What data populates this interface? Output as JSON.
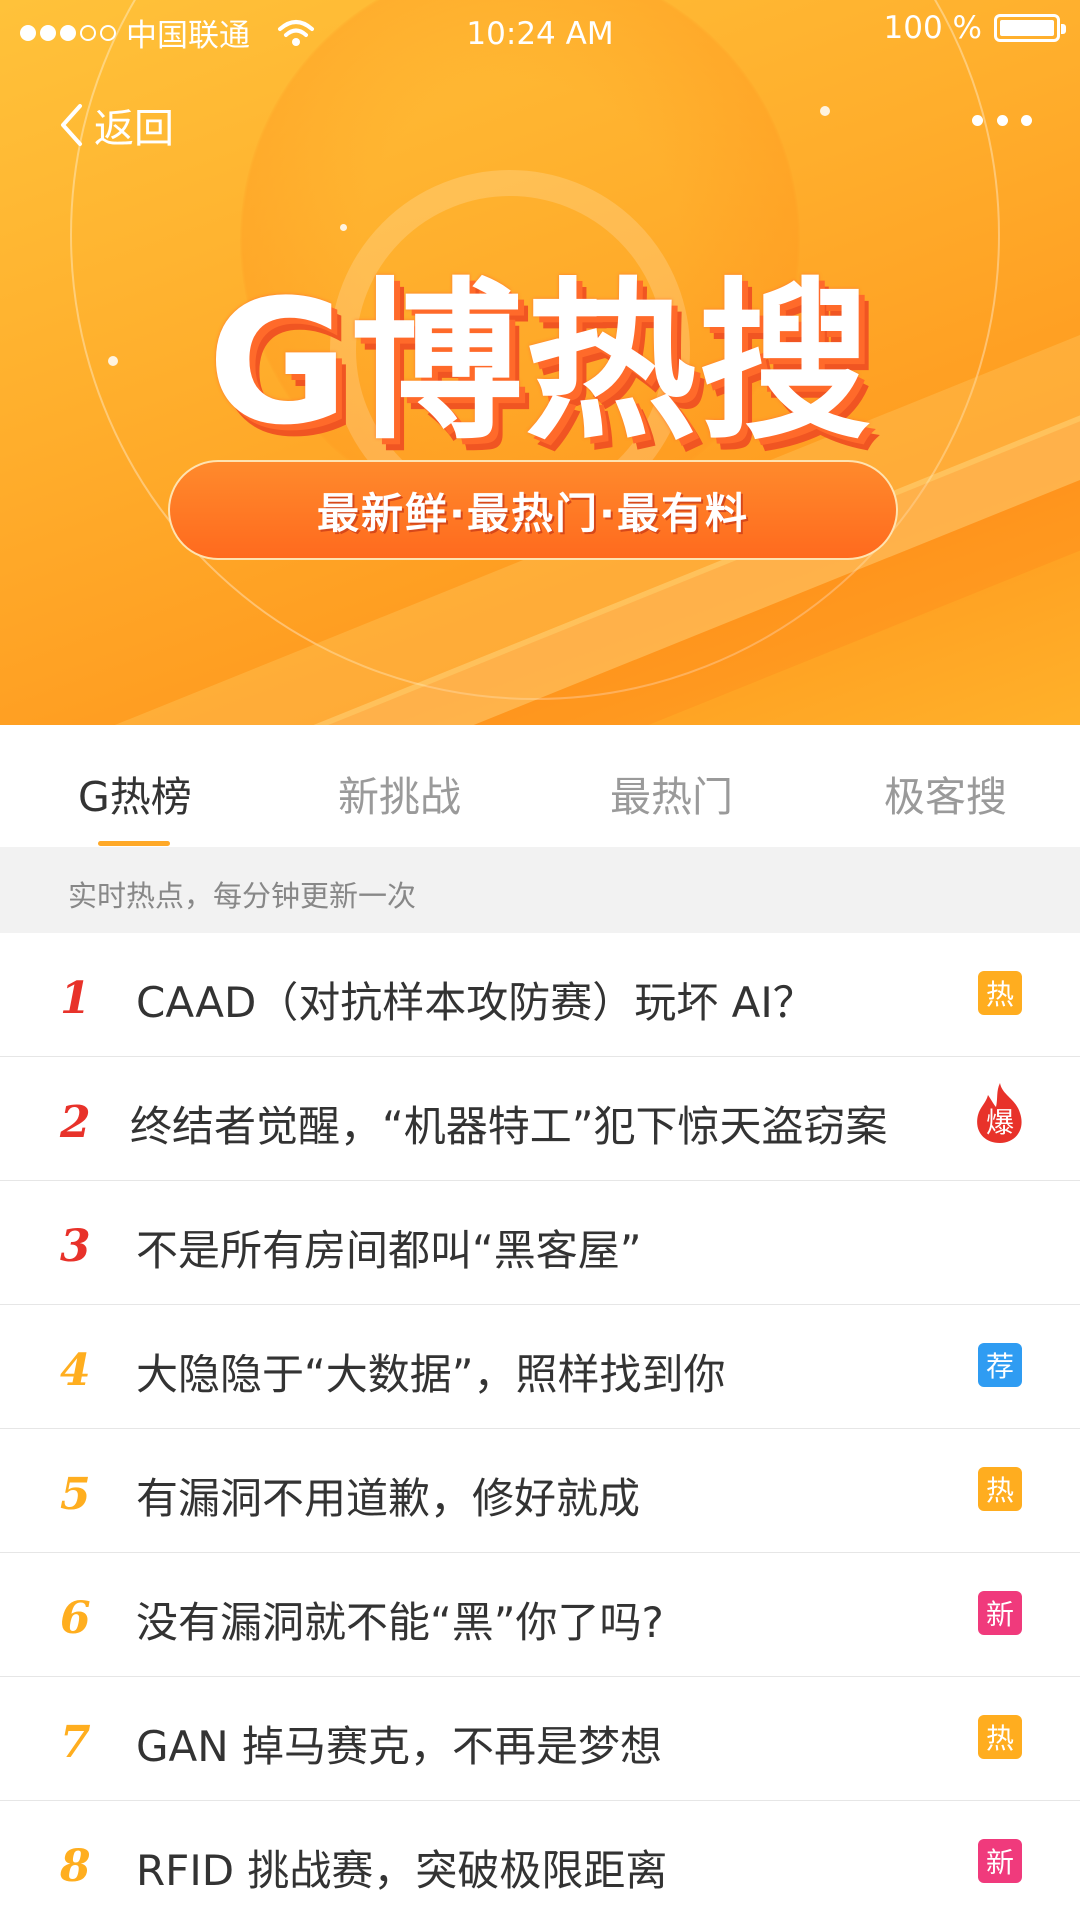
{
  "status_bar": {
    "carrier": "中国联通",
    "time": "10:24 AM",
    "battery": "100 %",
    "battery_level": 1.0
  },
  "nav": {
    "back_label": "返回"
  },
  "banner": {
    "title": "G博热搜",
    "slogan": "最新鲜·最热门·最有料"
  },
  "tabs": [
    {
      "label": "G热榜",
      "active": true
    },
    {
      "label": "新挑战",
      "active": false
    },
    {
      "label": "最热门",
      "active": false
    },
    {
      "label": "极客搜",
      "active": false
    }
  ],
  "subheader": "实时热点，每分钟更新一次",
  "colors": {
    "accent": "#ffa928",
    "rank_top": "#e8322a",
    "rank_rest": "#ffae1f",
    "badge_hot": "#ffad1f",
    "badge_recommend": "#2f9cf2",
    "badge_new": "#f03a7c",
    "badge_explode": "#e8322a"
  },
  "list": [
    {
      "rank": "1",
      "topic": "CAAD（对抗样本攻防赛）玩坏 AI？",
      "badge": "热",
      "badge_type": "hot"
    },
    {
      "rank": "2",
      "topic": "终结者觉醒，“机器特工”犯下惊天盗窃案",
      "badge": "爆",
      "badge_type": "explode"
    },
    {
      "rank": "3",
      "topic": "不是所有房间都叫“黑客屋”",
      "badge": "",
      "badge_type": "none"
    },
    {
      "rank": "4",
      "topic": "大隐隐于“大数据”，照样找到你",
      "badge": "荐",
      "badge_type": "rec"
    },
    {
      "rank": "5",
      "topic": "有漏洞不用道歉，修好就成",
      "badge": "热",
      "badge_type": "hot"
    },
    {
      "rank": "6",
      "topic": "没有漏洞就不能“黑”你了吗?",
      "badge": "新",
      "badge_type": "new"
    },
    {
      "rank": "7",
      "topic": "GAN 掉马赛克，不再是梦想",
      "badge": "热",
      "badge_type": "hot"
    },
    {
      "rank": "8",
      "topic": "RFID 挑战赛，突破极限距离",
      "badge": "新",
      "badge_type": "new"
    }
  ]
}
